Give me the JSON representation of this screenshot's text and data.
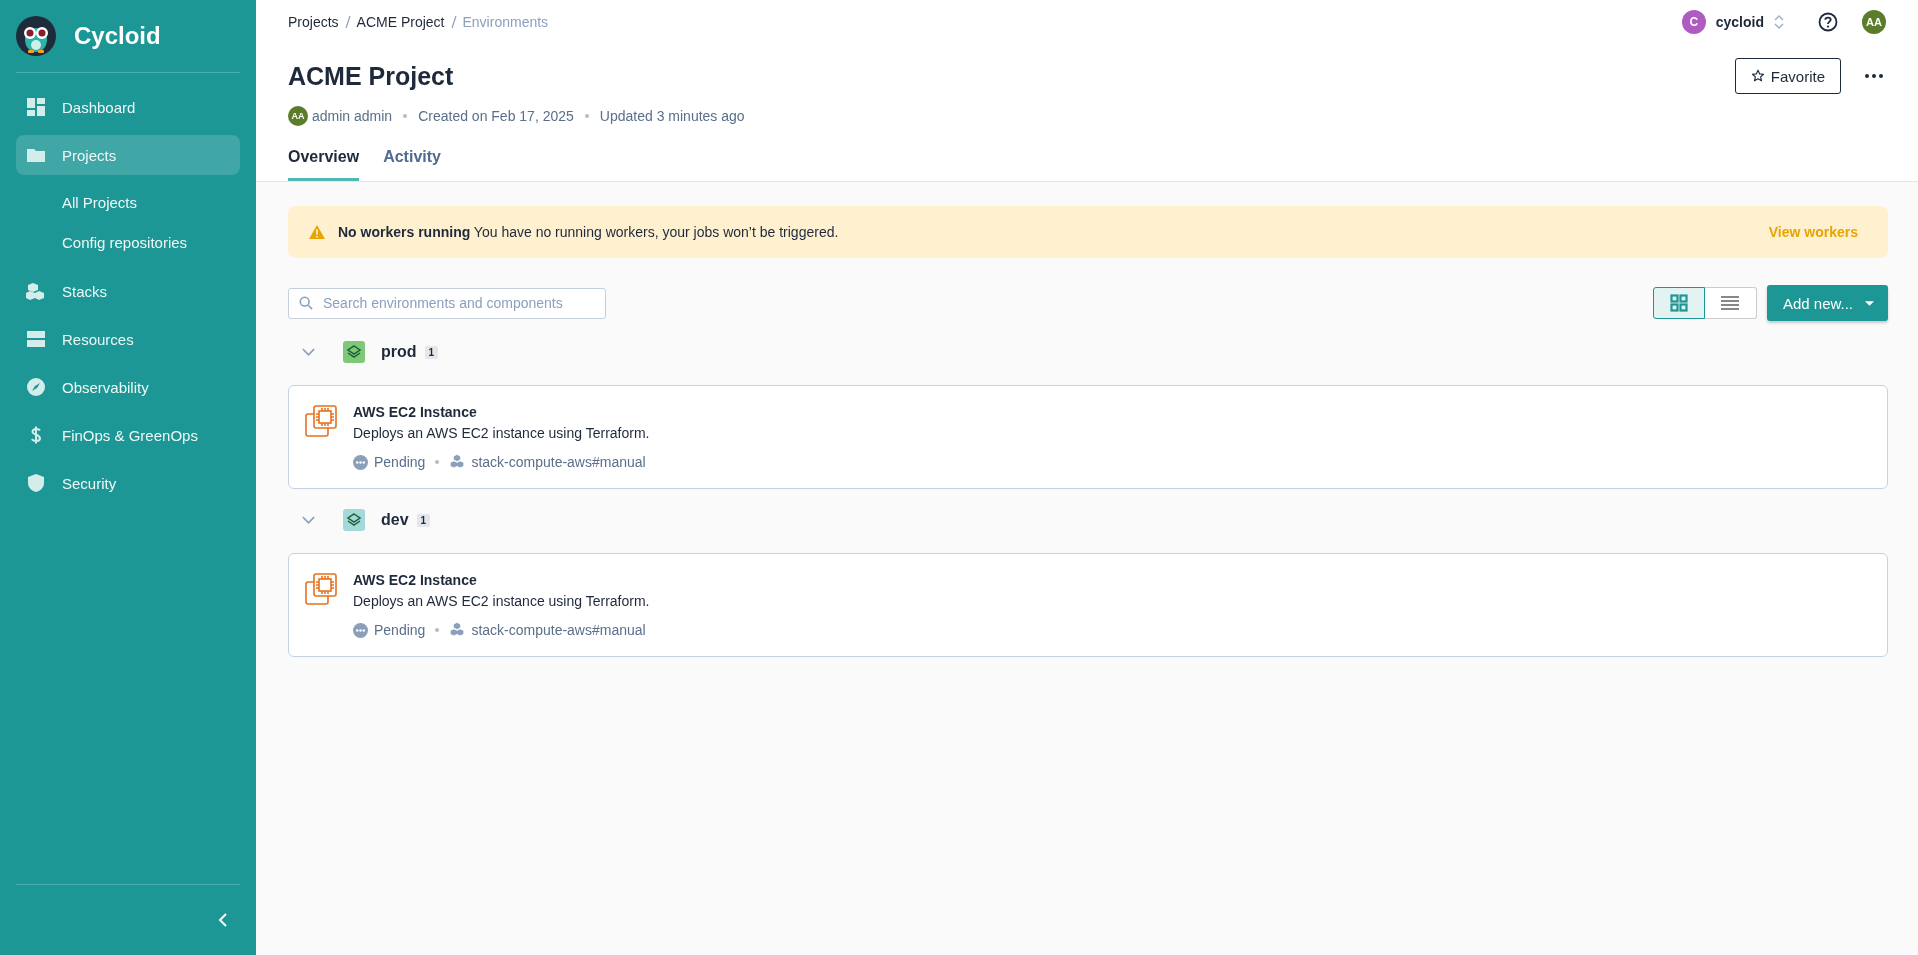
{
  "sidebar": {
    "brand": "Cycloid",
    "items": [
      {
        "label": "Dashboard",
        "selected": false
      },
      {
        "label": "Projects",
        "selected": true,
        "children": [
          {
            "label": "All Projects",
            "selected": false
          },
          {
            "label": "Config repositories",
            "selected": false
          }
        ]
      },
      {
        "label": "Stacks",
        "selected": false
      },
      {
        "label": "Resources",
        "selected": false
      },
      {
        "label": "Observability",
        "selected": false
      },
      {
        "label": "FinOps & GreenOps",
        "selected": false
      },
      {
        "label": "Security",
        "selected": false
      }
    ]
  },
  "breadcrumb": [
    "Projects",
    "ACME Project",
    "Environments"
  ],
  "org": {
    "initial": "C",
    "name": "cycloid"
  },
  "user": {
    "initials": "AA"
  },
  "project": {
    "title": "ACME Project",
    "owner_initials": "AA",
    "owner": "admin admin",
    "created": "Created on Feb 17, 2025",
    "updated": "Updated 3 minutes ago"
  },
  "favorite_button": "Favorite",
  "tabs": [
    {
      "label": "Overview",
      "selected": true
    },
    {
      "label": "Activity",
      "selected": false
    }
  ],
  "alert": {
    "title": "No workers running",
    "message": "You have no running workers, your jobs won’t be triggered.",
    "action": "View workers"
  },
  "search": {
    "placeholder": "Search environments and components"
  },
  "view_toggle": [
    {
      "kind": "grid",
      "selected": true
    },
    {
      "kind": "list",
      "selected": false
    }
  ],
  "add_button": "Add new...",
  "environments": [
    {
      "name": "prod",
      "count": "1",
      "color": "#7dc977",
      "expanded": true,
      "components": [
        {
          "name": "AWS EC2 Instance",
          "description": "Deploys an AWS EC2 instance using Terraform.",
          "status": "Pending",
          "stack": "stack-compute-aws#manual"
        }
      ]
    },
    {
      "name": "dev",
      "count": "1",
      "color": "#a3d9d6",
      "expanded": true,
      "components": [
        {
          "name": "AWS EC2 Instance",
          "description": "Deploys an AWS EC2 instance using Terraform.",
          "status": "Pending",
          "stack": "stack-compute-aws#manual"
        }
      ]
    }
  ]
}
